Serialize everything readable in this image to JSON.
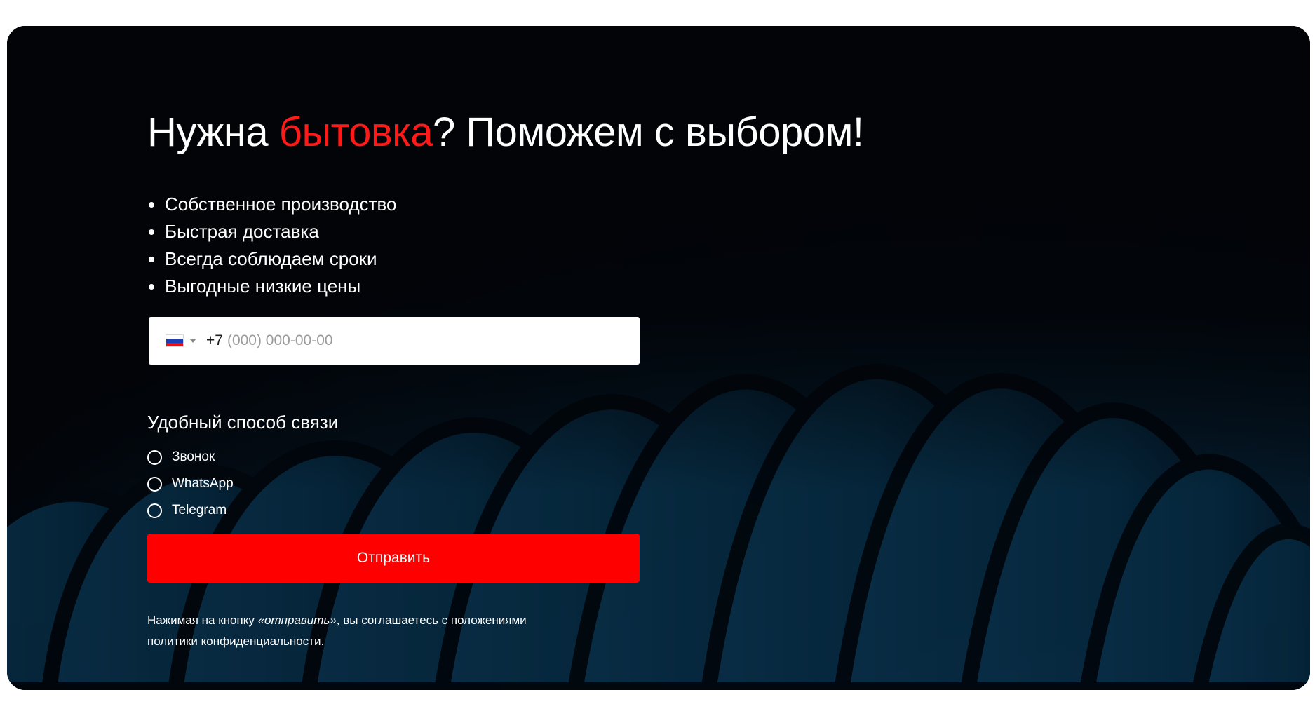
{
  "hero": {
    "title_before": "Нужна ",
    "title_accent": "бытовка",
    "title_after": "? Поможем с выбором!",
    "features": [
      "Собственное производство",
      "Быстрая доставка",
      "Всегда соблюдаем сроки",
      "Выгодные низкие цены"
    ]
  },
  "form": {
    "country_prefix": "+7",
    "phone_placeholder": "(000) 000-00-00",
    "phone_value": "",
    "contact_label": "Удобный способ связи",
    "contact_options": [
      "Звонок",
      "WhatsApp",
      "Telegram"
    ],
    "submit_label": "Отправить",
    "consent_text_1": "Нажимая на кнопку ",
    "consent_emphasis": "«отправить»",
    "consent_text_2": ", вы соглашаетесь с положениями ",
    "policy_link": "политики конфиденциальности",
    "consent_end": "."
  },
  "colors": {
    "accent": "#ff0000",
    "background": "#020408",
    "text": "#ffffff"
  },
  "icons": {
    "flag": "russia-flag-icon",
    "dropdown": "caret-down-icon",
    "radio": "radio-circle-icon"
  }
}
